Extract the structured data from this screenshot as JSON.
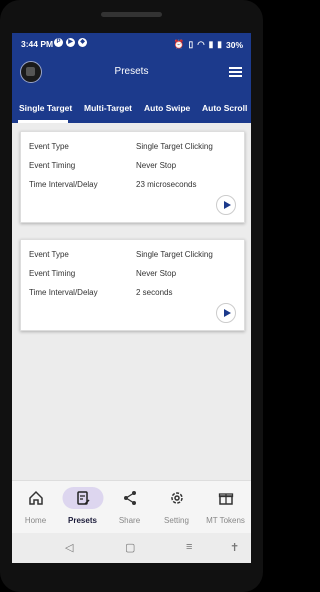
{
  "status": {
    "time": "3:44",
    "ampm": "PM",
    "battery": "30%"
  },
  "appbar": {
    "title": "Presets"
  },
  "tabs": [
    "Single Target",
    "Multi-Target",
    "Auto Swipe",
    "Auto Scroll"
  ],
  "cards": [
    {
      "rows": [
        {
          "label": "Event Type",
          "value": "Single Target Clicking"
        },
        {
          "label": "Event Timing",
          "value": "Never Stop"
        },
        {
          "label": "Time Interval/Delay",
          "value": "23 microseconds"
        }
      ]
    },
    {
      "rows": [
        {
          "label": "Event Type",
          "value": "Single Target Clicking"
        },
        {
          "label": "Event Timing",
          "value": "Never Stop"
        },
        {
          "label": "Time Interval/Delay",
          "value": "2 seconds"
        }
      ]
    }
  ],
  "nav": [
    "Home",
    "Presets",
    "Share",
    "Setting",
    "MT Tokens"
  ]
}
